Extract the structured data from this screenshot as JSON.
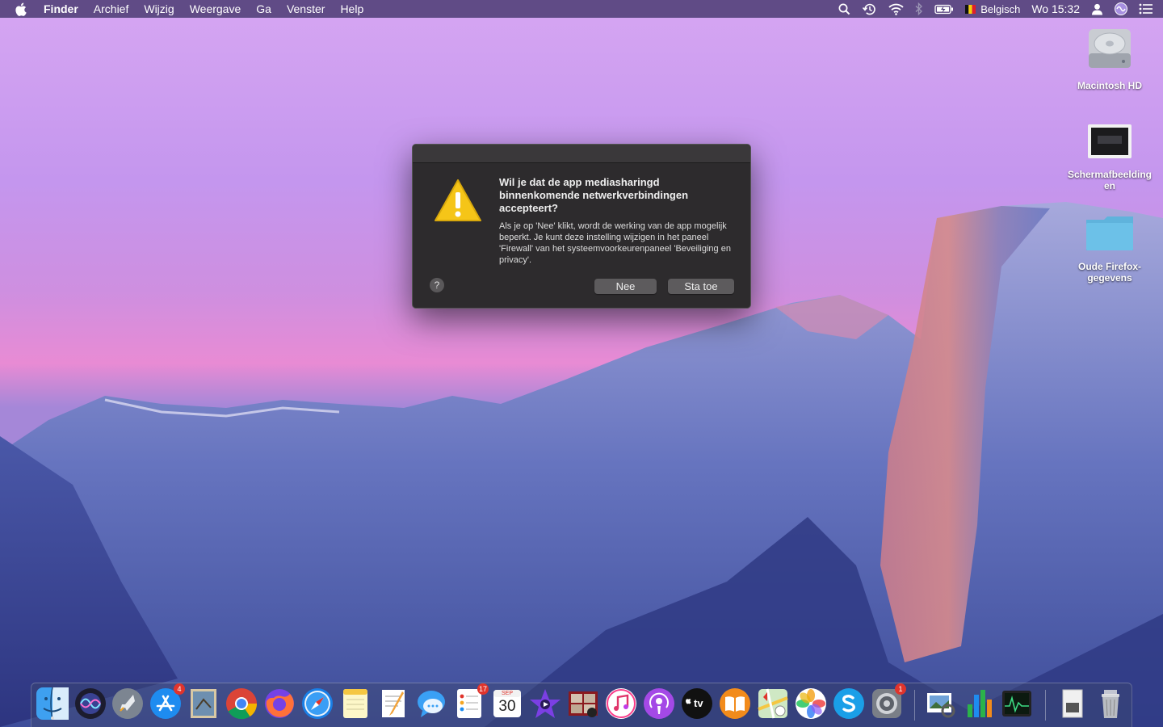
{
  "menubar": {
    "app_name": "Finder",
    "items": [
      "Archief",
      "Wijzig",
      "Weergave",
      "Ga",
      "Venster",
      "Help"
    ],
    "input_source": "Belgisch",
    "clock": "Wo 15:32"
  },
  "desktop": {
    "icons": [
      {
        "label": "Macintosh HD"
      },
      {
        "label": "Schermafbeelding en"
      },
      {
        "label": "Oude Firefox-gegevens"
      }
    ]
  },
  "dialog": {
    "title": "Wil je dat de app mediasharingd binnenkomende netwerkverbindingen accepteert?",
    "body": "Als je op 'Nee' klikt, wordt de werking van de app mogelijk beperkt. Je kunt deze instelling wijzigen in het paneel 'Firewall' van het systeemvoorkeurenpaneel 'Beveiliging en privacy'.",
    "help_label": "?",
    "deny_label": "Nee",
    "allow_label": "Sta toe"
  },
  "dock": {
    "appstore_badge": "4",
    "reminders_badge": "17",
    "calendar_month": "SEP",
    "calendar_day": "30",
    "prefs_badge": "1",
    "tv_label": "tv"
  },
  "colors": {
    "dialog_bg": "#2d2b2d",
    "button_bg": "#5d5b5d",
    "badge_red": "#e0342c",
    "warning_yellow": "#f5c518"
  }
}
